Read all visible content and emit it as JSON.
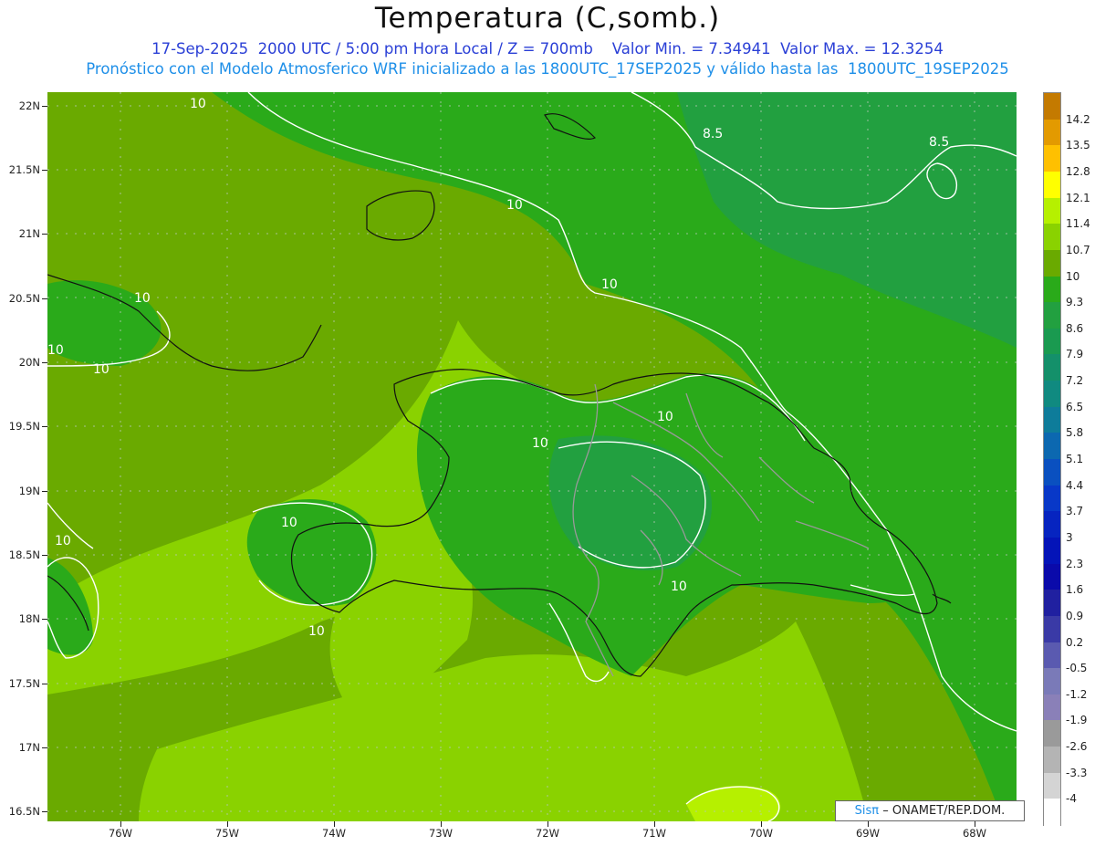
{
  "header": {
    "title": "Temperatura (C,somb.)",
    "line1": "17-Sep-2025  2000 UTC / 5:00 pm Hora Local / Z = 700mb    Valor Min. = 7.34941  Valor Max. = 12.3254",
    "line2": "Pronóstico con el Modelo Atmosferico WRF inicializado a las 1800UTC_17SEP2025 y válido hasta las  1800UTC_19SEP2025"
  },
  "axes": {
    "lat_labels": [
      "22N",
      "21.5N",
      "21N",
      "20.5N",
      "20N",
      "19.5N",
      "19N",
      "18.5N",
      "18N",
      "17.5N",
      "17N",
      "16.5N"
    ],
    "lon_labels": [
      "76W",
      "75W",
      "74W",
      "73W",
      "72W",
      "71W",
      "70W",
      "69W",
      "68W"
    ]
  },
  "contour_labels": [
    "10",
    "10",
    "10",
    "10",
    "10",
    "10",
    "10",
    "10",
    "10",
    "10",
    "10",
    "10",
    "8.5",
    "8.5"
  ],
  "colorbar": {
    "labels": [
      "14.2",
      "13.5",
      "12.8",
      "12.1",
      "11.4",
      "10.7",
      "10",
      "9.3",
      "8.6",
      "7.9",
      "7.2",
      "6.5",
      "5.8",
      "5.1",
      "4.4",
      "3.7",
      "3",
      "2.3",
      "1.6",
      "0.9",
      "0.2",
      "-0.5",
      "-1.2",
      "-1.9",
      "-2.6",
      "-3.3",
      "-4"
    ],
    "colors": [
      "#c47a00",
      "#e39a00",
      "#ffc000",
      "#ffff00",
      "#b6f000",
      "#8ad200",
      "#6aaa00",
      "#2aaa1a",
      "#22a040",
      "#1a9a50",
      "#14906a",
      "#108a80",
      "#0e7c9a",
      "#0c68b0",
      "#0a50c0",
      "#0838c8",
      "#0624c0",
      "#0414b8",
      "#0a0aaa",
      "#2020a0",
      "#3a3aa6",
      "#5a5ab0",
      "#7a7ab8",
      "#8a80b8",
      "#9a9a9a",
      "#b4b4b4",
      "#d4d4d4",
      "#ffffff"
    ]
  },
  "credit": {
    "sis": "Sisπ",
    "org": "– ONAMET/REP.DOM."
  }
}
